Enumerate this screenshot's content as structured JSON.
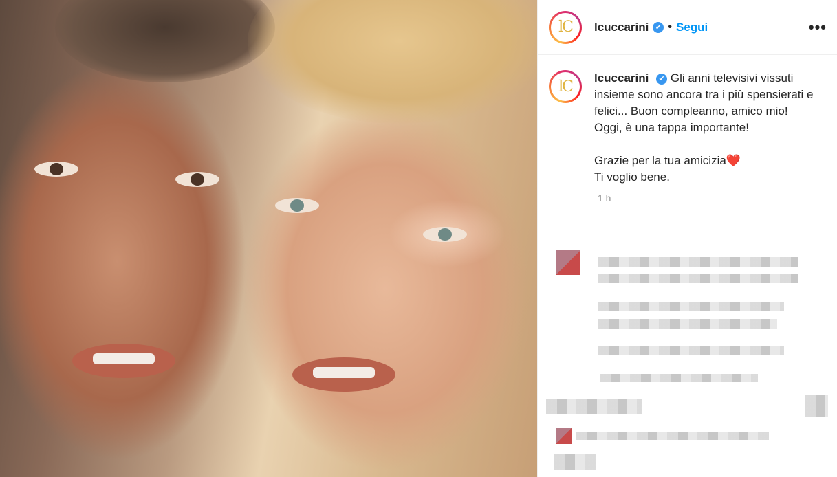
{
  "post": {
    "username": "lcuccarini",
    "verified_mark": "✔",
    "follow_label": "Segui",
    "more_label": "•••",
    "avatar_text": "lC",
    "caption_lines": [
      "Gli anni televisivi vissuti insieme sono ancora tra i più spensierati e felici... Buon compleanno, amico mio!",
      "Oggi, è una tappa importante!",
      "",
      "Grazie per la tua amicizia❤️",
      "Ti voglio bene."
    ],
    "time": "1 h"
  },
  "colors": {
    "accent": "#0095f6",
    "verified": "#3897f0"
  },
  "icons": [
    "verified-icon",
    "more-options-icon"
  ]
}
